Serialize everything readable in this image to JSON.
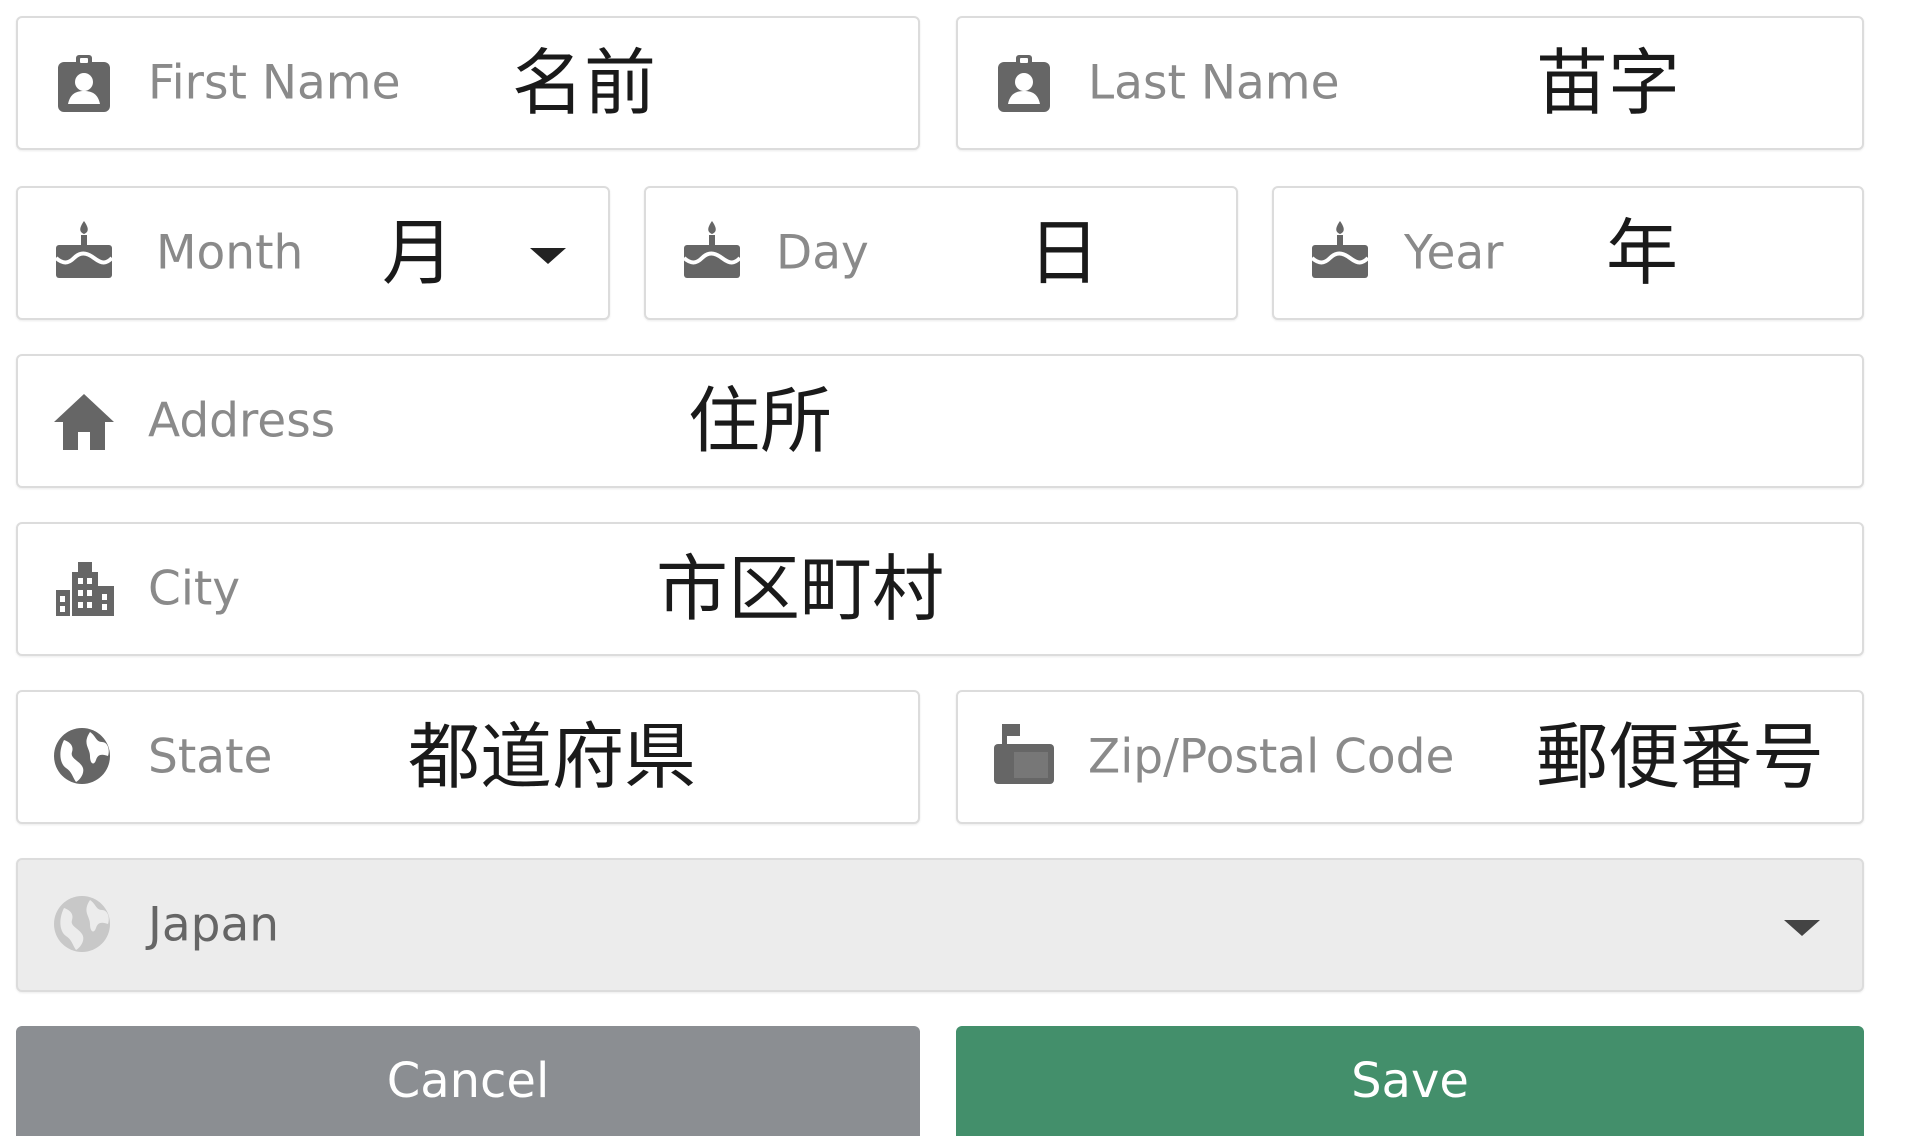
{
  "form": {
    "first_name": {
      "label": "First Name",
      "value": "名前",
      "icon": "contact-badge-icon"
    },
    "last_name": {
      "label": "Last Name",
      "value": "苗字",
      "icon": "contact-badge-icon"
    },
    "month": {
      "label": "Month",
      "value": "月",
      "icon": "birthday-cake-icon"
    },
    "day": {
      "label": "Day",
      "value": "日",
      "icon": "birthday-cake-icon"
    },
    "year": {
      "label": "Year",
      "value": "年",
      "icon": "birthday-cake-icon"
    },
    "address": {
      "label": "Address",
      "value": "住所",
      "icon": "home-icon"
    },
    "city": {
      "label": "City",
      "value": "市区町村",
      "icon": "city-buildings-icon"
    },
    "state": {
      "label": "State",
      "value": "都道府県",
      "icon": "globe-icon"
    },
    "zip": {
      "label": "Zip/Postal Code",
      "value": "郵便番号",
      "icon": "mailbox-icon"
    },
    "country": {
      "selected": "Japan",
      "icon": "globe-icon"
    }
  },
  "buttons": {
    "cancel": "Cancel",
    "save": "Save"
  },
  "colors": {
    "icon": "#666666",
    "label": "#8a8a8a",
    "value": "#1a1a1a",
    "border": "#dcdcdc",
    "country_bg": "#ececec",
    "cancel_bg": "#8b8e92",
    "save_bg": "#438f6b"
  }
}
